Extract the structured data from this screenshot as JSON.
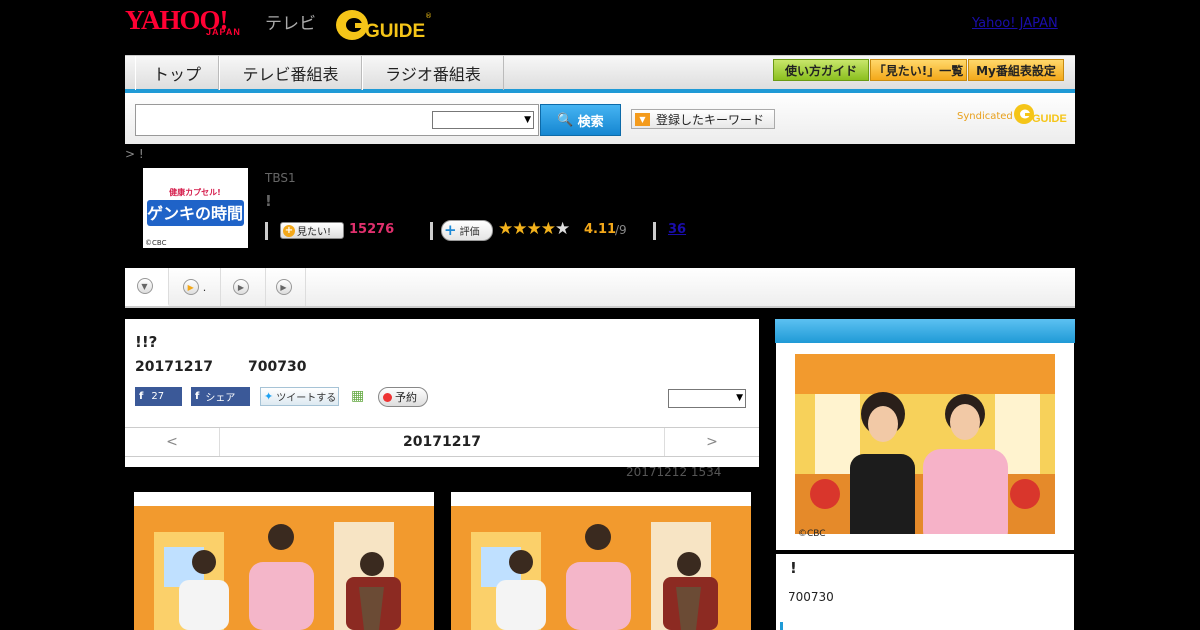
{
  "header": {
    "yahoo_logo": "YAHOO!",
    "yahoo_sub": "JAPAN",
    "tv_label": "テレビ",
    "gguide_logo": "G GUIDE",
    "yahoo_japan_link": "Yahoo! JAPAN"
  },
  "nav": {
    "tabs": [
      "トップ",
      "テレビ番組表",
      "ラジオ番組表"
    ],
    "buttons": [
      "使い方ガイド",
      "「見たい!」一覧",
      "My番組表設定"
    ]
  },
  "search": {
    "button_label": "検索",
    "keywords_label": "登録したキーワード",
    "syndicated_label": "Syndicated"
  },
  "breadcrumb": "> !",
  "program": {
    "thumb_title": "ゲンキの時間",
    "thumb_sub": "健康カプセル!",
    "thumb_credit": "©CBC",
    "channel": "TBS1",
    "title": "!",
    "mitai_label": "見たい!",
    "mitai_count": "15276",
    "hyoka_label": "評価",
    "rating": "4.11",
    "rating_of": "/9",
    "rating_value": 4.11,
    "reviews": "36"
  },
  "episode_tabs": [
    "",
    ".",
    "",
    ""
  ],
  "episode": {
    "subtitle": "!!?",
    "date": "20171217",
    "code": "700730",
    "fb_like_count": "27",
    "fb_share_label": "シェア",
    "tweet_label": "ツイートする",
    "reserve_label": "予約",
    "pager_prev": "<",
    "pager_date": "20171217",
    "pager_next": ">",
    "updated": "20171212  1534"
  },
  "sidebar": {
    "photo_credit": "©CBC",
    "title": "!",
    "code": "700730"
  },
  "colors": {
    "accent_blue": "#1f9ad6",
    "yahoo_red": "#ff0033",
    "gguide_yellow": "#f5c518",
    "mitai_pink": "#e0306d"
  }
}
